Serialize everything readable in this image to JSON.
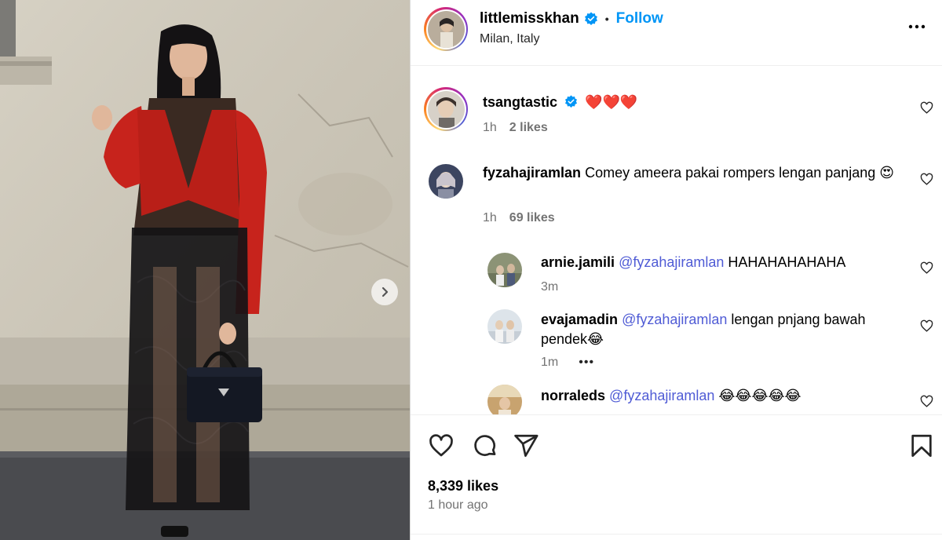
{
  "post_header": {
    "username": "littlemisskhan",
    "separator": "•",
    "follow_label": "Follow",
    "location": "Milan, Italy"
  },
  "comments": [
    {
      "username": "tsangtastic",
      "text": "❤️❤️❤️",
      "time": "1h",
      "likes": "2 likes"
    },
    {
      "username": "fyzahajiramlan",
      "text": "Comey ameera pakai rompers lengan panjang 😍",
      "time": "1h",
      "likes": "69 likes"
    }
  ],
  "replies": [
    {
      "username": "arnie.jamili",
      "mention": "@fyzahajiramlan",
      "text": "HAHAHAHAHAHA",
      "time": "3m"
    },
    {
      "username": "evajamadin",
      "mention": "@fyzahajiramlan",
      "text": "lengan pnjang bawah pendek😂",
      "time": "1m",
      "more": "•••"
    },
    {
      "username": "norraleds",
      "mention": "@fyzahajiramlan",
      "text": "😂😂😂😂😂"
    }
  ],
  "footer": {
    "likes": "8,339 likes",
    "time": "1 hour ago"
  },
  "icons": {
    "like": "heart-icon",
    "comment": "comment-bubble-icon",
    "share": "paper-plane-icon",
    "save": "bookmark-icon",
    "verified": "verified-badge-icon",
    "more": "more-options-icon",
    "next": "chevron-right-icon"
  },
  "colors": {
    "follow": "#0095f6",
    "mention": "#4f5bd5",
    "verified": "#0095f6",
    "secondary_text": "#737373"
  }
}
